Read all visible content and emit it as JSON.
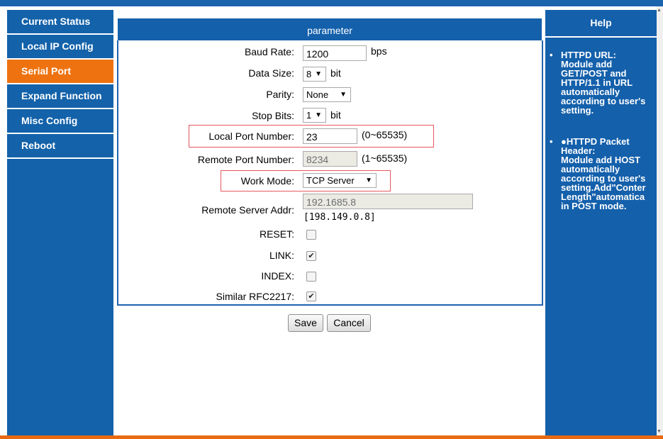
{
  "sidebar": {
    "items": [
      {
        "label": "Current Status",
        "active": false
      },
      {
        "label": "Local IP Config",
        "active": false
      },
      {
        "label": "Serial Port",
        "active": true
      },
      {
        "label": "Expand Function",
        "active": false
      },
      {
        "label": "Misc Config",
        "active": false
      },
      {
        "label": "Reboot",
        "active": false
      }
    ]
  },
  "panel": {
    "title": "parameter",
    "baud_rate": {
      "label": "Baud Rate:",
      "value": "1200",
      "unit": "bps"
    },
    "data_size": {
      "label": "Data Size:",
      "value": "8",
      "unit": "bit"
    },
    "parity": {
      "label": "Parity:",
      "value": "None"
    },
    "stop_bits": {
      "label": "Stop Bits:",
      "value": "1",
      "unit": "bit"
    },
    "local_port": {
      "label": "Local Port Number:",
      "value": "23",
      "range": "(0~65535)"
    },
    "remote_port": {
      "label": "Remote Port Number:",
      "value": "8234",
      "range": "(1~65535)"
    },
    "work_mode": {
      "label": "Work Mode:",
      "value": "TCP Server"
    },
    "remote_server": {
      "label": "Remote Server Addr:",
      "value": "192.1685.8",
      "note": "[198.149.0.8]"
    },
    "reset": {
      "label": "RESET:",
      "checked": false
    },
    "link": {
      "label": "LINK:",
      "checked": true
    },
    "index": {
      "label": "INDEX:",
      "checked": false
    },
    "rfc2217": {
      "label": "Similar RFC2217:",
      "checked": true
    }
  },
  "buttons": {
    "save": "Save",
    "cancel": "Cancel"
  },
  "help": {
    "title": "Help",
    "items": [
      {
        "bullet": "•",
        "lines": [
          "HTTPD URL:",
          "Module add",
          "GET/POST and",
          "HTTP/1.1 in URL",
          "automatically",
          "according to user's",
          "setting."
        ]
      },
      {
        "bullet": "•",
        "lines": [
          "●HTTPD Packet",
          "Header:",
          "Module add HOST",
          "automatically",
          "according to user's",
          "setting.Add\"Conter",
          "Length\"automatica",
          "in POST mode."
        ]
      }
    ]
  },
  "colors": {
    "nav_blue": "#1362aa",
    "active_orange": "#ee7310",
    "highlight_red": "#e4585e"
  }
}
